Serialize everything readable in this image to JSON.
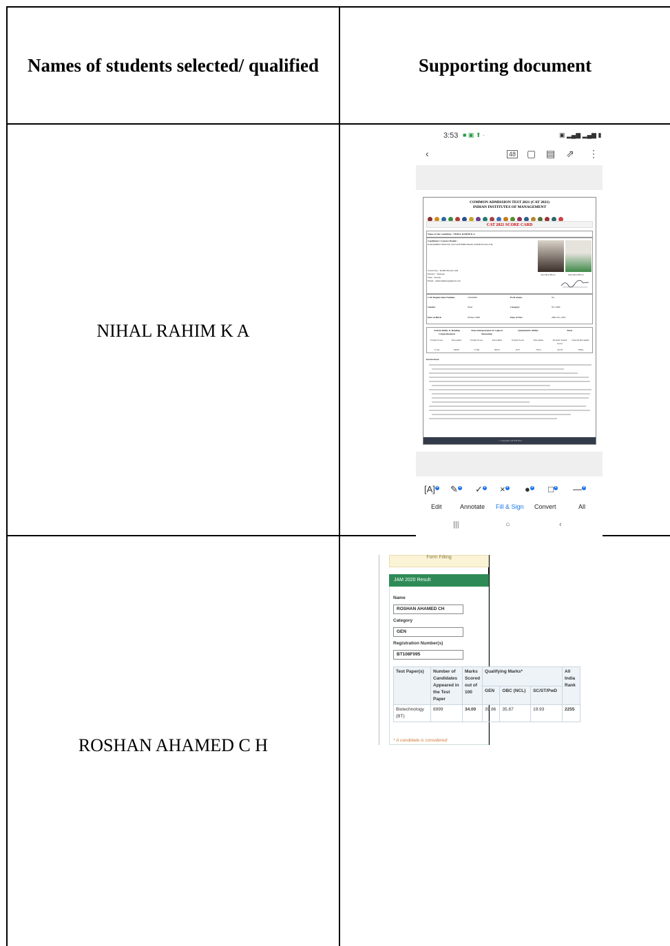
{
  "table": {
    "headers": {
      "names": "Names of students selected/ qualified",
      "documents": "Supporting document"
    },
    "rows": [
      {
        "name": "NIHAL RAHIM K A"
      },
      {
        "name": "ROSHAN AHAMED C H"
      }
    ]
  },
  "phone_screenshot": {
    "status_time": "3:53",
    "page_counter": "48",
    "card_title_1": "COMMON ADMISSION TEST 2021 (CAT 2021)",
    "card_title_2": "INDIAN INSTITUTES OF MANAGEMENT",
    "score_card_title": "CAT 2021 SCORE CARD",
    "candidate_line": "Name of the Candidate : NIHAL RAHIM K A",
    "contact_label": "Candidate's Contact Details :",
    "address": "KADAMBOT HOUSE, P.O SANTHIPURAM, KODUNGALLUR,",
    "town": "Town/City : KODUNGALLUR",
    "district": "District : Thrissur",
    "state": "State : Kerala",
    "email": "Email : nihalrahimka@gmail.com",
    "test_day_photo": "Test Day Photo",
    "uploaded_photo": "Uploaded Photo",
    "reg_label": "CAT Registration Number",
    "reg_value": "21000000",
    "pwd_label": "PwD Status",
    "pwd_value": "No",
    "gender_label": "Gender",
    "gender_value": "Male",
    "category_label": "Category",
    "category_value": "NC-OBC",
    "dob_label": "Date of Birth",
    "dob_value": "06/Dec/2000",
    "dot_label": "Date of Test",
    "dot_value": "28th Nov 2021",
    "score_headers": [
      "Verbal Ability & Reading Comprehension",
      "Data Interpretation & Logical Reasoning",
      "Quantitative Ability",
      "Total"
    ],
    "score_sub": [
      "Scaled Score",
      "Percentile",
      "Scaled Score",
      "Percentile",
      "Scaled Score",
      "Percentile",
      "Overall Scaled Score",
      "Overall Percentile"
    ],
    "score_values": [
      "17.44",
      "69.95",
      "17.99",
      "86.47",
      "8.37",
      "78.31",
      "43.79",
      "78.84"
    ],
    "instructions_label": "Instructions:",
    "copyright": "© Copyright CAT IIM 2021",
    "bottom_tools": [
      "Edit",
      "Annotate",
      "Fill & Sign",
      "Convert",
      "All"
    ],
    "accent": "#1a73e8"
  },
  "jam_screenshot": {
    "top_tab": "Form Filling",
    "header": "JAM 2020 Result",
    "name_label": "Name",
    "name_value": "ROSHAN AHAMED CH",
    "category_label": "Category",
    "category_value": "GEN",
    "reg_label": "Registration Number(s)",
    "reg_value": "BT108F095",
    "table_headers": [
      "Test Paper(s)",
      "Number of Candidates Appeared in the Test Paper",
      "Marks Scored out of 100",
      "Qualifying Marks*",
      "All India Rank"
    ],
    "qualifying_sub": [
      "GEN",
      "OBC (NCL)",
      "SC/ST/PwD"
    ],
    "row": {
      "paper": "Biotechnology (BT)",
      "candidates": "8999",
      "marks": "34.00",
      "gen": "39.86",
      "obc": "35.87",
      "sc": "19.93",
      "rank": "2255"
    },
    "footnote": "* A candidate is considered",
    "accent": "#2e8b57"
  }
}
